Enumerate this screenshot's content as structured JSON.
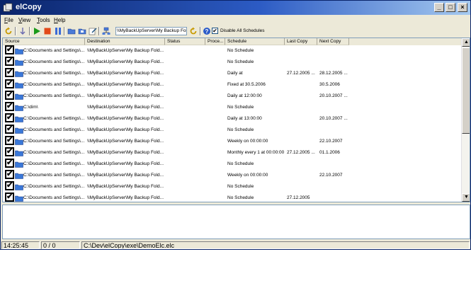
{
  "window": {
    "title": "elCopy",
    "controls": [
      "_",
      "□",
      "×"
    ]
  },
  "menu": [
    {
      "key": "F",
      "rest": "ile"
    },
    {
      "key": "V",
      "rest": "iew"
    },
    {
      "key": "T",
      "rest": "ools"
    },
    {
      "key": "H",
      "rest": "elp"
    }
  ],
  "toolbar": {
    "path_value": "\\\\MyBackUpServer\\My Backup Fol",
    "disable_all_label": "Disable All Schedules",
    "disable_all_checked": "✔"
  },
  "columns": [
    "Source",
    "Destination",
    "Status",
    "Proce...",
    "Schedule",
    "Last Copy",
    "Next Copy"
  ],
  "rows": [
    {
      "check": "✔",
      "source": "C:\\Documents and Settings\\...",
      "dest": "\\\\MyBackUpServer\\My Backup Fold...",
      "status": "",
      "proc": "",
      "schedule": "No Schedule",
      "last": "",
      "next": ""
    },
    {
      "check": "✔",
      "source": "C:\\Documents and Settings\\...",
      "dest": "\\\\MyBackUpServer\\My Backup Fold...",
      "status": "",
      "proc": "",
      "schedule": "No Schedule",
      "last": "",
      "next": ""
    },
    {
      "check": "✔",
      "source": "C:\\Documents and Settings\\...",
      "dest": "\\\\MyBackUpServer\\My Backup Fold...",
      "status": "",
      "proc": "",
      "schedule": "Daily at",
      "last": "27.12.2005 ...",
      "next": "28.12.2005 ..."
    },
    {
      "check": "✔",
      "source": "C:\\Documents and Settings\\...",
      "dest": "\\\\MyBackUpServer\\My Backup Fold...",
      "status": "",
      "proc": "",
      "schedule": "Fixed at 30.5.2006",
      "last": "",
      "next": "30.5.2006"
    },
    {
      "check": "✔",
      "source": "C:\\Documents and Settings\\...",
      "dest": "\\\\MyBackUpServer\\My Backup Fold...",
      "status": "",
      "proc": "",
      "schedule": "Daily at 12:00:00",
      "last": "",
      "next": "20.10.2007 ..."
    },
    {
      "check": "✔",
      "source": "C:\\dim\\",
      "dest": "\\\\MyBackUpServer\\My Backup Fold...",
      "status": "",
      "proc": "",
      "schedule": "No Schedule",
      "last": "",
      "next": ""
    },
    {
      "check": "✔",
      "source": "C:\\Documents and Settings\\...",
      "dest": "\\\\MyBackUpServer\\My Backup Fold...",
      "status": "",
      "proc": "",
      "schedule": "Daily at 13:00:00",
      "last": "",
      "next": "20.10.2007 ..."
    },
    {
      "check": "✔",
      "source": "C:\\Documents and Settings\\...",
      "dest": "\\\\MyBackUpServer\\My Backup Fold...",
      "status": "",
      "proc": "",
      "schedule": "No Schedule",
      "last": "",
      "next": ""
    },
    {
      "check": "✔",
      "source": "C:\\Documents and Settings\\...",
      "dest": "\\\\MyBackUpServer\\My Backup Fold...",
      "status": "",
      "proc": "",
      "schedule": "Weekly on  00:00:00",
      "last": "",
      "next": "22.10.2007"
    },
    {
      "check": "✔",
      "source": "C:\\Documents and Settings\\...",
      "dest": "\\\\MyBackUpServer\\My Backup Fold...",
      "status": "",
      "proc": "",
      "schedule": "Monthly every 1 at 00:00:00",
      "last": "27.12.2005 ...",
      "next": "01.1.2006"
    },
    {
      "check": "✔",
      "source": "C:\\Documents and Settings\\...",
      "dest": "\\\\MyBackUpServer\\My Backup Fold...",
      "status": "",
      "proc": "",
      "schedule": "No Schedule",
      "last": "",
      "next": ""
    },
    {
      "check": "✔",
      "source": "C:\\Documents and Settings\\...",
      "dest": "\\\\MyBackUpServer\\My Backup Fold...",
      "status": "",
      "proc": "",
      "schedule": "Weekly on  00:00:00",
      "last": "",
      "next": "22.10.2007"
    },
    {
      "check": "✔",
      "source": "C:\\Documents and Settings\\...",
      "dest": "\\\\MyBackUpServer\\My Backup Fold...",
      "status": "",
      "proc": "",
      "schedule": "No Schedule",
      "last": "",
      "next": ""
    },
    {
      "check": "✔",
      "source": "C:\\Documents and Settings\\...",
      "dest": "\\\\MyBackUpServer\\My Backup Fold...",
      "status": "",
      "proc": "",
      "schedule": "No Schedule",
      "last": "27.12.2005",
      "next": ""
    }
  ],
  "statusbar": {
    "time": "14:25:45",
    "count": "0 / 0",
    "file": "C:\\Dev\\elCopy\\exe\\DemoElc.elc"
  },
  "colors": {
    "title_start": "#0a246a",
    "title_end": "#a6caf0",
    "chrome": "#ece9d8",
    "folder": "#3a78d8"
  }
}
